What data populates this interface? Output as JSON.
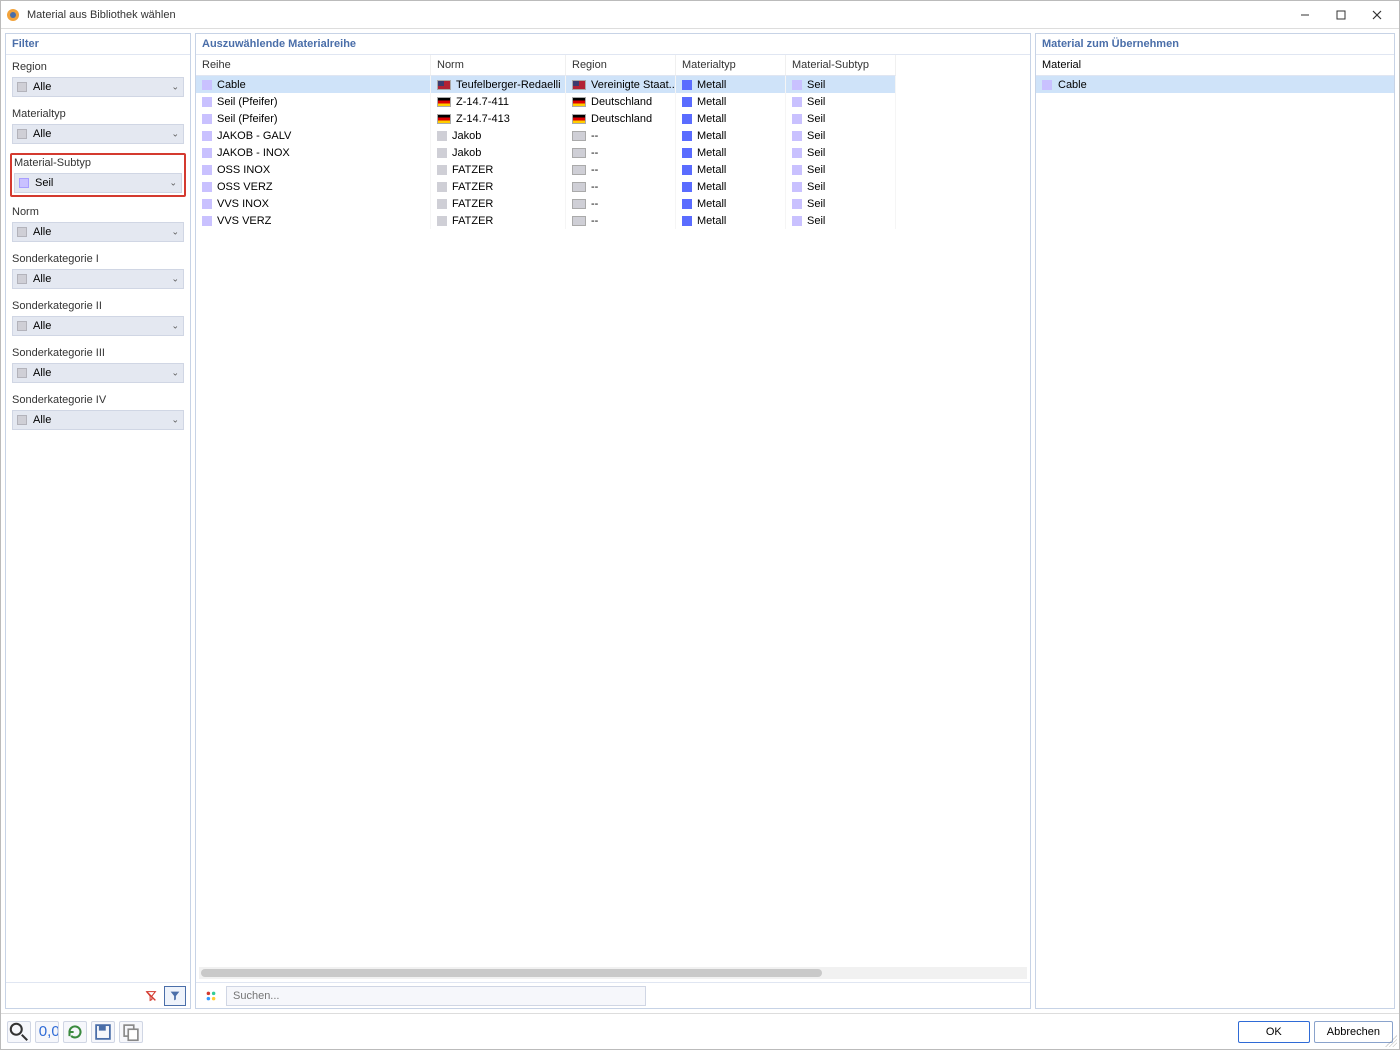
{
  "window": {
    "title": "Material aus Bibliothek wählen"
  },
  "filter_panel": {
    "title": "Filter",
    "groups": [
      {
        "key": "region",
        "label": "Region",
        "value": "Alle",
        "swatch": "gray",
        "highlight": false
      },
      {
        "key": "mattyp",
        "label": "Materialtyp",
        "value": "Alle",
        "swatch": "gray",
        "highlight": false
      },
      {
        "key": "matsub",
        "label": "Material-Subtyp",
        "value": "Seil",
        "swatch": "purple",
        "highlight": true
      },
      {
        "key": "norm",
        "label": "Norm",
        "value": "Alle",
        "swatch": "gray",
        "highlight": false
      },
      {
        "key": "sk1",
        "label": "Sonderkategorie I",
        "value": "Alle",
        "swatch": "gray",
        "highlight": false
      },
      {
        "key": "sk2",
        "label": "Sonderkategorie II",
        "value": "Alle",
        "swatch": "gray",
        "highlight": false
      },
      {
        "key": "sk3",
        "label": "Sonderkategorie III",
        "value": "Alle",
        "swatch": "gray",
        "highlight": false
      },
      {
        "key": "sk4",
        "label": "Sonderkategorie IV",
        "value": "Alle",
        "swatch": "gray",
        "highlight": false
      }
    ]
  },
  "center": {
    "title": "Auszuwählende Materialreihe",
    "columns": [
      "Reihe",
      "Norm",
      "Region",
      "Materialtyp",
      "Material-Subtyp"
    ],
    "rows": [
      {
        "reihe": "Cable",
        "norm": "Teufelberger-Redaelli",
        "region": "Vereinigte Staat...",
        "flag": "us",
        "typ": "Metall",
        "sub": "Seil",
        "selected": true
      },
      {
        "reihe": "Seil (Pfeifer)",
        "norm": "Z-14.7-411",
        "region": "Deutschland",
        "flag": "de",
        "typ": "Metall",
        "sub": "Seil"
      },
      {
        "reihe": "Seil (Pfeifer)",
        "norm": "Z-14.7-413",
        "region": "Deutschland",
        "flag": "de",
        "typ": "Metall",
        "sub": "Seil"
      },
      {
        "reihe": "JAKOB - GALV",
        "norm": "Jakob",
        "region": "--",
        "flag": "none",
        "typ": "Metall",
        "sub": "Seil"
      },
      {
        "reihe": "JAKOB - INOX",
        "norm": "Jakob",
        "region": "--",
        "flag": "none",
        "typ": "Metall",
        "sub": "Seil"
      },
      {
        "reihe": "OSS INOX",
        "norm": "FATZER",
        "region": "--",
        "flag": "none",
        "typ": "Metall",
        "sub": "Seil"
      },
      {
        "reihe": "OSS VERZ",
        "norm": "FATZER",
        "region": "--",
        "flag": "none",
        "typ": "Metall",
        "sub": "Seil"
      },
      {
        "reihe": "VVS INOX",
        "norm": "FATZER",
        "region": "--",
        "flag": "none",
        "typ": "Metall",
        "sub": "Seil"
      },
      {
        "reihe": "VVS VERZ",
        "norm": "FATZER",
        "region": "--",
        "flag": "none",
        "typ": "Metall",
        "sub": "Seil"
      }
    ],
    "search_placeholder": "Suchen..."
  },
  "right": {
    "title": "Material zum Übernehmen",
    "column": "Material",
    "rows": [
      {
        "name": "Cable",
        "selected": true
      }
    ]
  },
  "footer": {
    "ok": "OK",
    "cancel": "Abbrechen"
  }
}
